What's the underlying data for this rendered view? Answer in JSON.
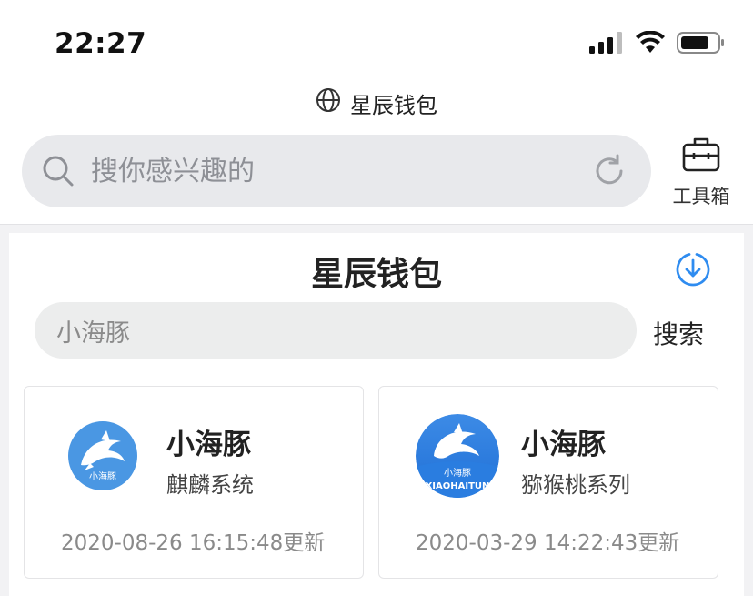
{
  "status_bar": {
    "time": "22:27",
    "icons": [
      "signal-icon",
      "wifi-icon",
      "battery-icon"
    ]
  },
  "browser": {
    "title": "星辰钱包",
    "globe_icon": "globe-icon"
  },
  "top_search": {
    "placeholder": "搜你感兴趣的"
  },
  "toolbox": {
    "label": "工具箱"
  },
  "panel": {
    "title": "星辰钱包",
    "search_value": "小海豚",
    "search_button": "搜索"
  },
  "apps": [
    {
      "name": "小海豚",
      "series": "麒麟系统",
      "updated": "2020-08-26 16:15:48更新",
      "logo_text": "小海豚"
    },
    {
      "name": "小海豚",
      "series": "猕猴桃系列",
      "updated": "2020-03-29 14:22:43更新",
      "logo_text": "小海豚",
      "logo_subtext": "XIAOHAITUN"
    }
  ],
  "colors": {
    "accent": "#2f8cf0",
    "search_bg": "#e8e9ec"
  }
}
